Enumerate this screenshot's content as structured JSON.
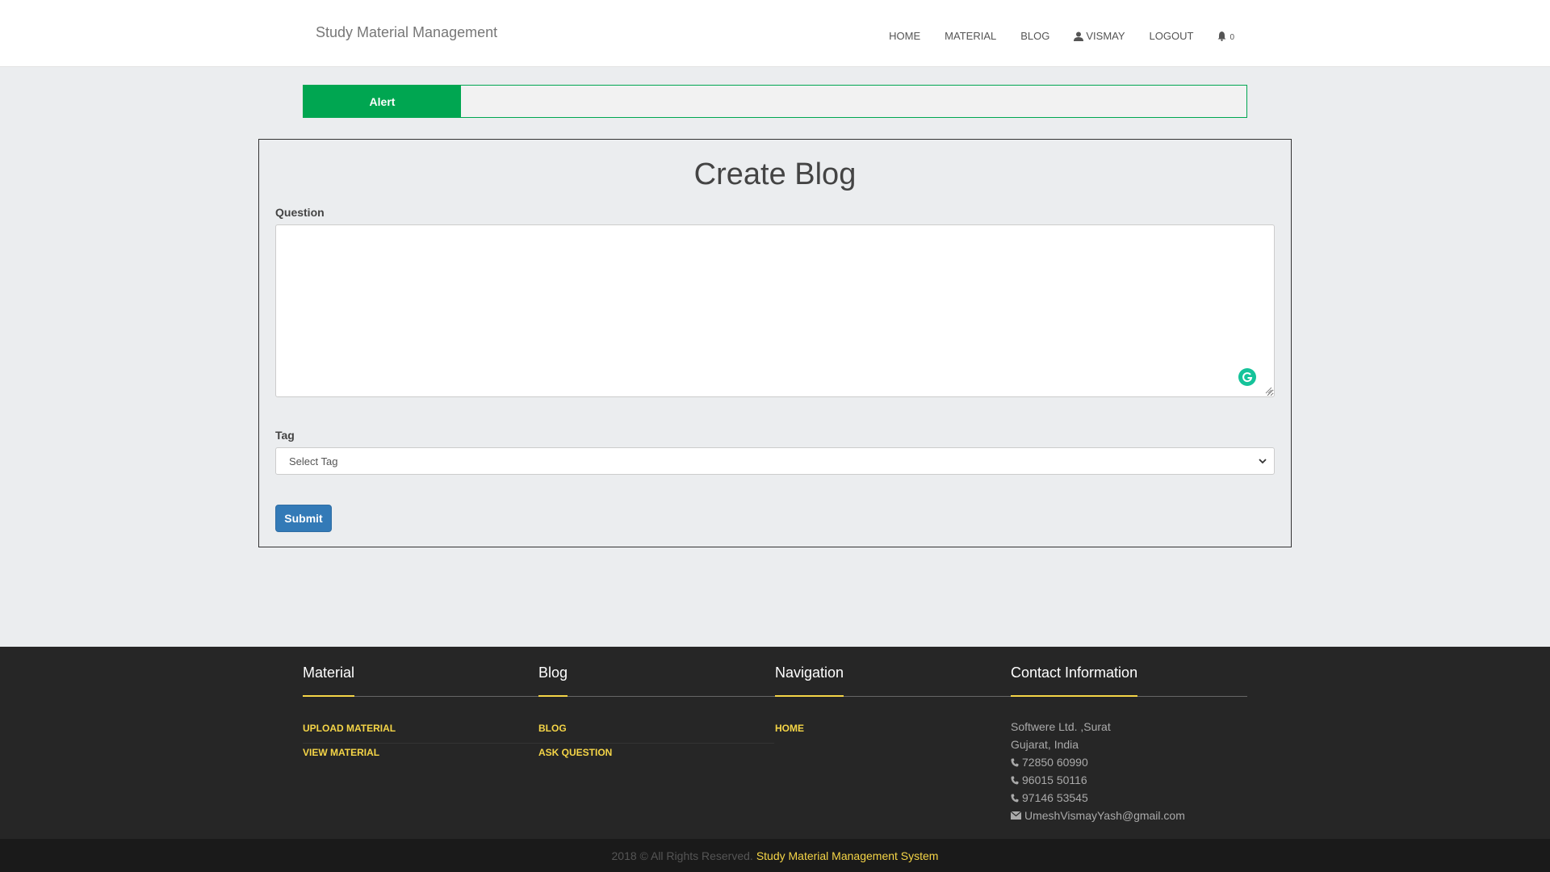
{
  "brand": "Study Material Management",
  "nav": {
    "items": [
      {
        "label": "HOME",
        "icon": ""
      },
      {
        "label": "MATERIAL",
        "icon": ""
      },
      {
        "label": "BLOG",
        "icon": ""
      },
      {
        "label": "VISMAY",
        "icon": "user-icon"
      },
      {
        "label": "LOGOUT",
        "icon": ""
      }
    ],
    "notification_count": "0"
  },
  "alert": {
    "label": "Alert",
    "message": ""
  },
  "form": {
    "title": "Create Blog",
    "question_label": "Question",
    "question_value": "",
    "tag_label": "Tag",
    "tag_selected": "Select Tag",
    "submit_label": "Submit"
  },
  "footer": {
    "columns": [
      {
        "heading": "Material",
        "links": [
          "UPLOAD MATERIAL",
          "VIEW MATERIAL"
        ]
      },
      {
        "heading": "Blog",
        "links": [
          "BLOG",
          "ASK QUESTION"
        ]
      },
      {
        "heading": "Navigation",
        "links": [
          "HOME"
        ]
      }
    ],
    "contact": {
      "heading": "Contact Information",
      "address_line1": "Softwere Ltd. ,Surat",
      "address_line2": "Gujarat, India",
      "phones": [
        "72850 60990",
        "96015 50116",
        "97146 53545"
      ],
      "email": "UmeshVismayYash@gmail.com"
    }
  },
  "copyright": {
    "text": "2018 © All Rights Reserved.",
    "brand": "Study Material Management System"
  },
  "colors": {
    "accent_green": "#00a651",
    "accent_yellow": "#f5d547",
    "primary_blue": "#337ab7",
    "footer_bg": "#262626"
  }
}
